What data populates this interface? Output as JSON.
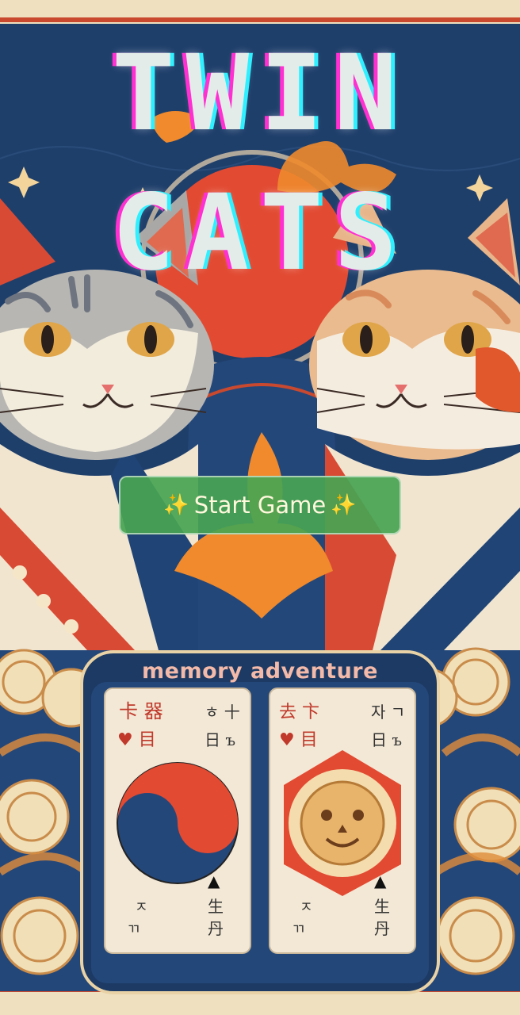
{
  "game": {
    "title_line1": "TWIN",
    "title_line2": "CATS",
    "start_button": {
      "sparkle": "✨",
      "label": "Start Game"
    },
    "subtitle": "memory adventure"
  },
  "colors": {
    "background": "#1f3f6b",
    "title_fill": "#e4ece9",
    "title_glitch_pink": "#ff2fd2",
    "title_glitch_cyan": "#2ff0ff",
    "start_button": "#48a452",
    "accent_red": "#e24a32",
    "accent_orange": "#f08a2c"
  },
  "icons": {
    "left_card": "yin-yang-icon",
    "right_card": "tiger-mask-icon",
    "sparkle": "sparkle-icon",
    "leaf": "maple-leaf-icon"
  }
}
